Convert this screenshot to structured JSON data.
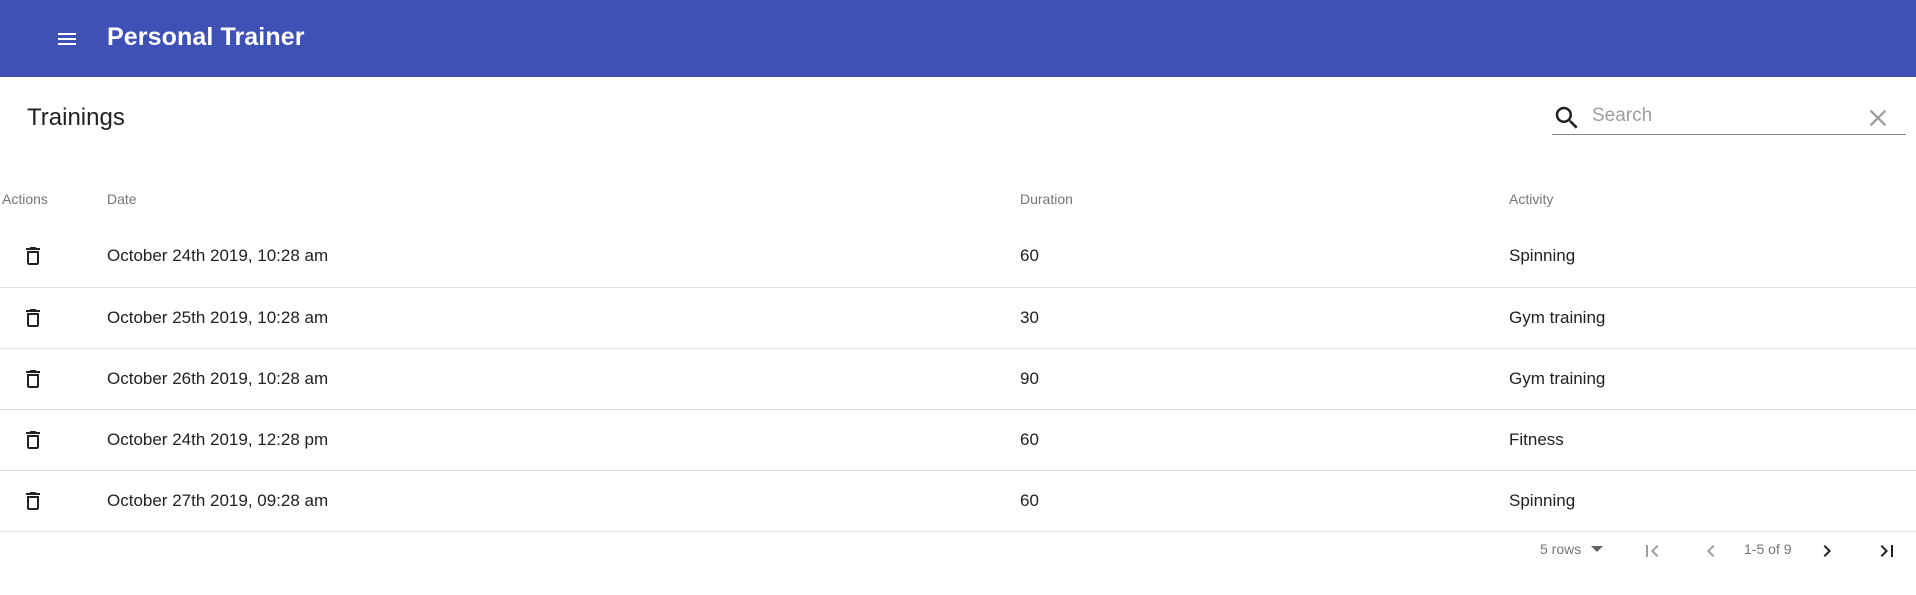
{
  "app": {
    "title": "Personal Trainer"
  },
  "table": {
    "title": "Trainings",
    "search_placeholder": "Search",
    "search_value": "",
    "columns": [
      "Actions",
      "Date",
      "Duration",
      "Activity"
    ],
    "rows": [
      {
        "date": "October 24th 2019, 10:28 am",
        "duration": "60",
        "activity": "Spinning"
      },
      {
        "date": "October 25th 2019, 10:28 am",
        "duration": "30",
        "activity": "Gym training"
      },
      {
        "date": "October 26th 2019, 10:28 am",
        "duration": "90",
        "activity": "Gym training"
      },
      {
        "date": "October 24th 2019, 12:28 pm",
        "duration": "60",
        "activity": "Fitness"
      },
      {
        "date": "October 27th 2019, 09:28 am",
        "duration": "60",
        "activity": "Spinning"
      }
    ]
  },
  "pagination": {
    "rows_per_page_label": "5 rows",
    "range_label": "1-5 of 9"
  },
  "icons": {
    "menu": "menu-icon",
    "search": "search-icon",
    "clear": "close-icon",
    "delete": "delete-icon",
    "first_page": "first-page-icon",
    "prev_page": "chevron-left-icon",
    "next_page": "chevron-right-icon",
    "last_page": "last-page-icon"
  },
  "colors": {
    "appbar": "#3f51b5",
    "appbar_text": "#ffffff",
    "divider": "#e0e0e0"
  }
}
